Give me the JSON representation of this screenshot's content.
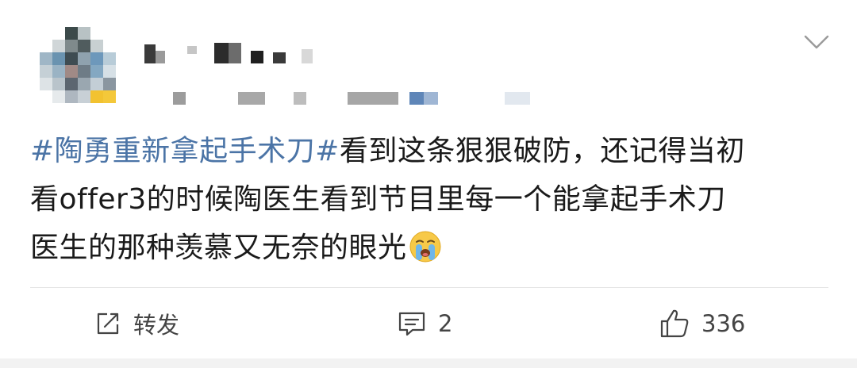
{
  "post": {
    "content": {
      "topic": "#陶勇重新拿起手术刀#",
      "line1_rest": "看到这条狠狠破防，还记得当初",
      "line2": "看offer3的时候陶医生看到节目里每一个能拿起手术刀",
      "line3": "医生的那种羡慕又无奈的眼光",
      "emoji_name": "crying-face-emoji"
    },
    "actions": {
      "repost_label": "转发",
      "comment_count": "2",
      "like_count": "336"
    },
    "icons": {
      "repost": "share-square-icon",
      "comment": "comment-bubble-icon",
      "like": "thumbs-up-icon",
      "menu": "chevron-down-icon"
    },
    "colors": {
      "topic": "#4b74a6",
      "text": "#1a1a1a",
      "action_text": "#444444"
    }
  }
}
